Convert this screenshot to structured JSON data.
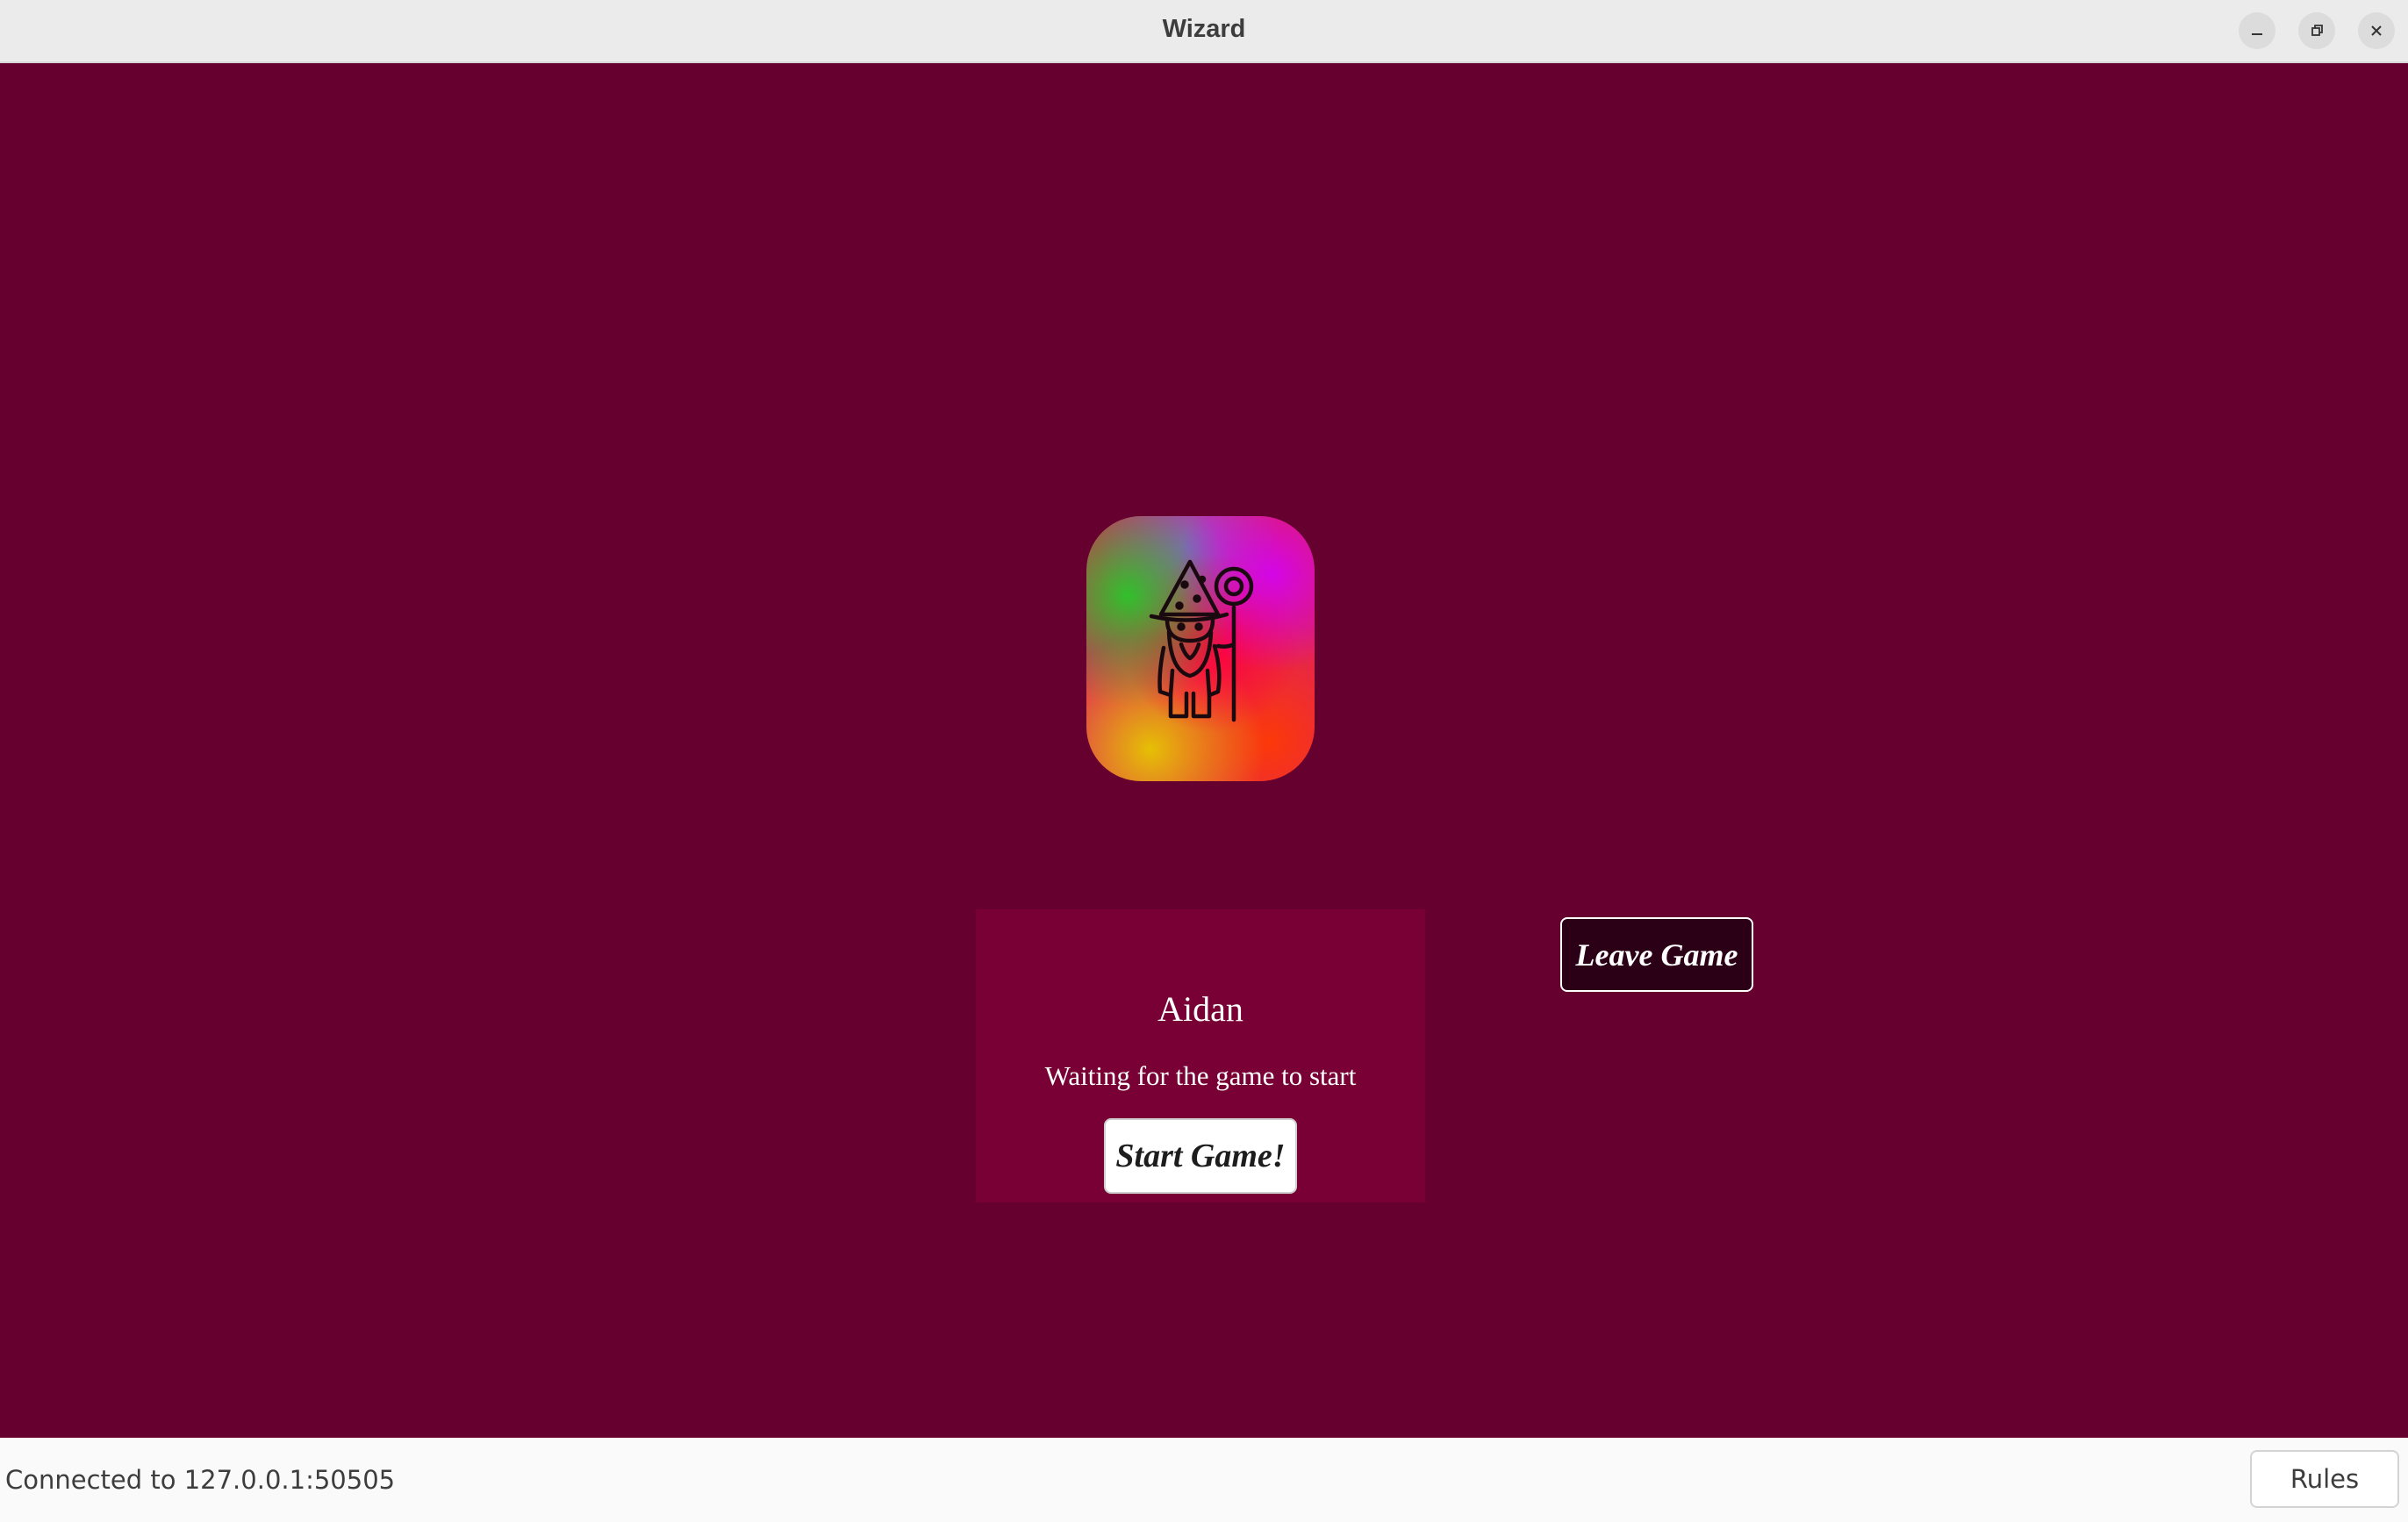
{
  "window": {
    "title": "Wizard",
    "controls": [
      "minimize-icon",
      "maximize-icon",
      "close-icon"
    ]
  },
  "logo": {
    "icon": "wizard-icon"
  },
  "player": {
    "name": "Aidan",
    "status": "Waiting for the game to start",
    "start_label": "Start Game!"
  },
  "actions": {
    "leave_label": "Leave Game"
  },
  "statusbar": {
    "connection": "Connected to 127.0.0.1:50505",
    "rules_label": "Rules"
  },
  "colors": {
    "background": "#66002f",
    "card": "#780035",
    "leave_button": "#2b0017",
    "titlebar": "#ebebeb",
    "statusbar": "#fafafa"
  }
}
